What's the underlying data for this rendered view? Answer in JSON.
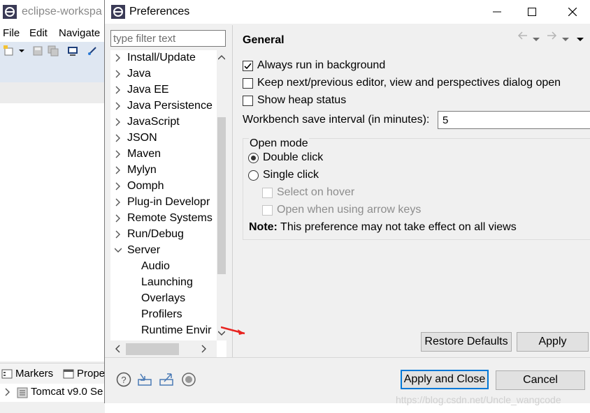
{
  "background_window": {
    "title": "eclipse-workspa",
    "menu": [
      "File",
      "Edit",
      "Navigate"
    ],
    "bottom_tabs": [
      "Markers",
      "Prope"
    ],
    "server_row": "Tomcat v9.0 Se"
  },
  "dialog": {
    "title": "Preferences",
    "filter": {
      "placeholder": "type filter text",
      "value": ""
    },
    "tree": [
      {
        "label": "Install/Update",
        "expanded": false
      },
      {
        "label": "Java",
        "expanded": false
      },
      {
        "label": "Java EE",
        "expanded": false
      },
      {
        "label": "Java Persistence",
        "expanded": false
      },
      {
        "label": "JavaScript",
        "expanded": false
      },
      {
        "label": "JSON",
        "expanded": false
      },
      {
        "label": "Maven",
        "expanded": false
      },
      {
        "label": "Mylyn",
        "expanded": false
      },
      {
        "label": "Oomph",
        "expanded": false
      },
      {
        "label": "Plug-in Developr",
        "expanded": false
      },
      {
        "label": "Remote Systems",
        "expanded": false
      },
      {
        "label": "Run/Debug",
        "expanded": false
      },
      {
        "label": "Server",
        "expanded": true
      },
      {
        "label": "Audio",
        "child": true
      },
      {
        "label": "Launching",
        "child": true
      },
      {
        "label": "Overlays",
        "child": true
      },
      {
        "label": "Profilers",
        "child": true
      },
      {
        "label": "Runtime Envir",
        "child": true
      }
    ],
    "page": {
      "title": "General",
      "checkboxes": [
        {
          "label": "Always run in background",
          "checked": true
        },
        {
          "label": "Keep next/previous editor, view and perspectives dialog open",
          "checked": false
        },
        {
          "label": "Show heap status",
          "checked": false
        }
      ],
      "interval_label": "Workbench save interval (in minutes):",
      "interval_value": "5",
      "open_mode": {
        "title": "Open mode",
        "double_click": "Double click",
        "single_click": "Single click",
        "selected": "Double click",
        "select_on_hover": "Select on hover",
        "open_arrow_keys": "Open when using arrow keys",
        "note_bold": "Note:",
        "note_text": " This preference may not take effect on all views"
      }
    },
    "buttons": {
      "restore_defaults": "Restore Defaults",
      "apply": "Apply",
      "apply_and_close": "Apply and Close",
      "cancel": "Cancel"
    },
    "watermark": "https://blog.csdn.net/Uncle_wangcode"
  }
}
